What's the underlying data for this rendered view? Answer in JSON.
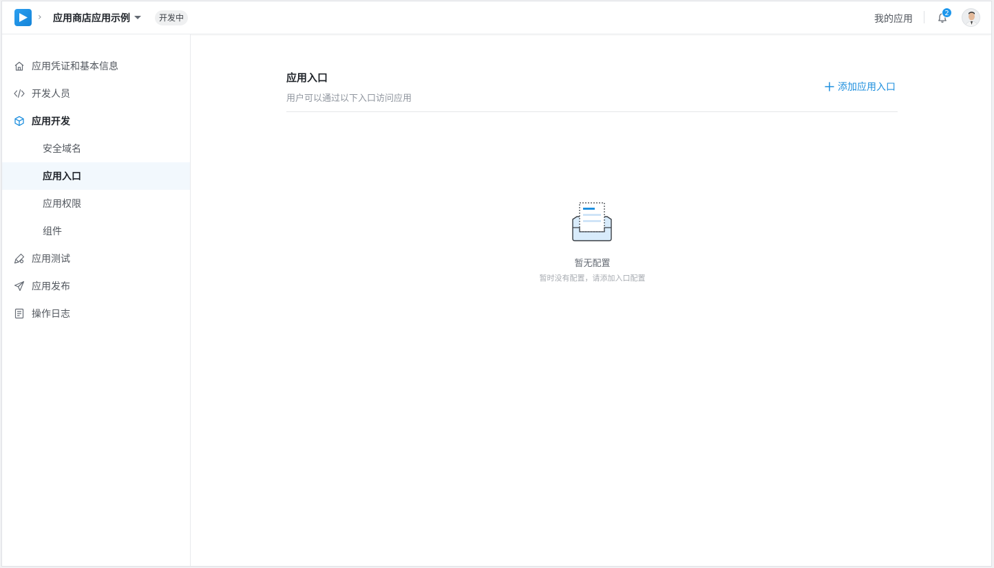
{
  "header": {
    "app_name": "应用商店应用示例",
    "status_tag": "开发中",
    "my_apps": "我的应用",
    "notification_count": "2"
  },
  "sidebar": {
    "items": [
      {
        "label": "应用凭证和基本信息",
        "icon": "home-icon"
      },
      {
        "label": "开发人员",
        "icon": "code-icon"
      },
      {
        "label": "应用开发",
        "icon": "cube-icon"
      },
      {
        "label": "安全域名"
      },
      {
        "label": "应用入口"
      },
      {
        "label": "应用权限"
      },
      {
        "label": "组件"
      },
      {
        "label": "应用测试",
        "icon": "test-tool-icon"
      },
      {
        "label": "应用发布",
        "icon": "paper-plane-icon"
      },
      {
        "label": "操作日志",
        "icon": "log-icon"
      }
    ],
    "active": "应用入口"
  },
  "main": {
    "title": "应用入口",
    "description": "用户可以通过以下入口访问应用",
    "add_button": "添加应用入口",
    "empty_title": "暂无配置",
    "empty_desc": "暂时没有配置，请添加入口配置"
  },
  "colors": {
    "accent": "#1e8fde",
    "active_bg": "#f2f8fd",
    "badge": "#1e97ec"
  }
}
